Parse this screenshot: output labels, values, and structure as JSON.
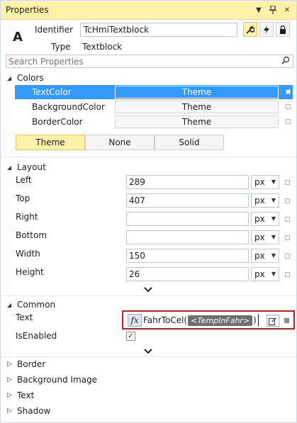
{
  "window": {
    "title": "Properties"
  },
  "header": {
    "glyph": "A",
    "identifier_label": "Identifier",
    "identifier_value": "TcHmiTextblock",
    "type_label": "Type",
    "type_value": "Textblock"
  },
  "search": {
    "placeholder": "Search Properties"
  },
  "colors": {
    "title": "Colors",
    "rows": [
      {
        "label": "TextColor",
        "value": "Theme"
      },
      {
        "label": "BackgroundColor",
        "value": "Theme"
      },
      {
        "label": "BorderColor",
        "value": "Theme"
      }
    ],
    "modes": [
      "Theme",
      "None",
      "Solid"
    ]
  },
  "layout": {
    "title": "Layout",
    "rows": [
      {
        "label": "Left",
        "value": "289",
        "unit": "px"
      },
      {
        "label": "Top",
        "value": "407",
        "unit": "px"
      },
      {
        "label": "Right",
        "value": "",
        "unit": "px"
      },
      {
        "label": "Bottom",
        "value": "",
        "unit": "px"
      },
      {
        "label": "Width",
        "value": "150",
        "unit": "px"
      },
      {
        "label": "Height",
        "value": "26",
        "unit": "px"
      }
    ]
  },
  "common": {
    "title": "Common",
    "text_label": "Text",
    "fx_label": "fx",
    "text_func": "FahrToCel(",
    "text_token": "<TempInFahr>",
    "text_close": ")",
    "isenabled_label": "IsEnabled",
    "isenabled_check": "✓"
  },
  "collapsed": [
    "Border",
    "Background Image",
    "Text",
    "Shadow"
  ],
  "accent": "#3399ff",
  "highlight": "#fff1a8"
}
